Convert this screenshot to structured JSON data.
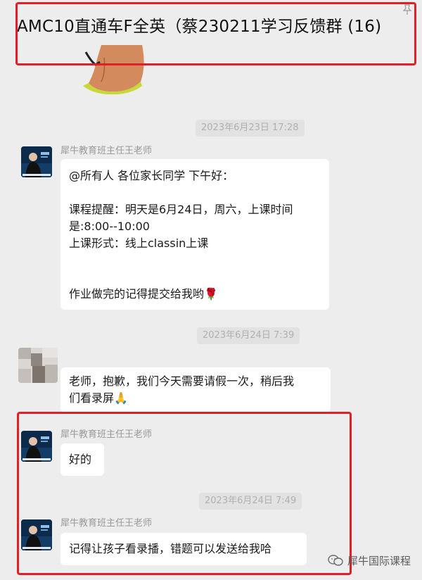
{
  "header": {
    "title": "AMC10直通车F全英（蔡230211学习反馈群 (16)"
  },
  "messages": [
    {
      "time": "2023年6月23日 17:28",
      "sender": "犀牛教育班主任王老师",
      "lines": [
        "@所有人  各位家长同学 下午好：",
        "",
        "课程提醒：明天是6月24日，周六，上课时间",
        "是:8:00--10:00",
        "上课形式：线上classin上课",
        "",
        "",
        " 作业做完的记得提交给我哟🌹"
      ]
    },
    {
      "time": "2023年6月24日 7:39",
      "lines": [
        "老师，抱歉，我们今天需要请假一次，稍后我",
        "们看录屏🙏"
      ]
    },
    {
      "sender": "犀牛教育班主任王老师",
      "text": "好的"
    },
    {
      "time": "2023年6月24日 7:49",
      "sender": "犀牛教育班主任王老师",
      "text": "记得让孩子看录播，错题可以发送给我哈"
    }
  ],
  "watermark": {
    "label": "犀牛国际课程",
    "icon": "wechat-channel-icon"
  },
  "colors": {
    "background": "#ededed",
    "bubble": "#ffffff",
    "timestamp": "#b0b0b0",
    "highlight": "#e21f26"
  }
}
